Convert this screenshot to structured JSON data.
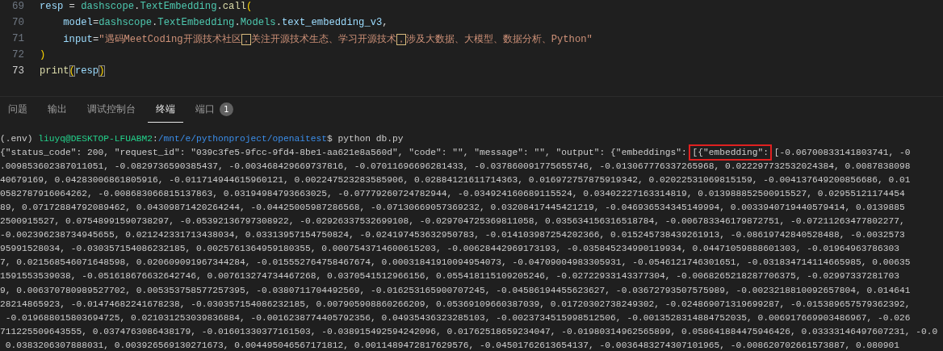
{
  "editor": {
    "lines": [
      {
        "number": "69",
        "current": false,
        "indented": false,
        "tokens": [
          {
            "text": "resp",
            "kind": "var"
          },
          {
            "text": " = ",
            "kind": "plain"
          },
          {
            "text": "dashscope",
            "kind": "class"
          },
          {
            "text": ".",
            "kind": "plain"
          },
          {
            "text": "TextEmbedding",
            "kind": "class"
          },
          {
            "text": ".",
            "kind": "plain"
          },
          {
            "text": "call",
            "kind": "func"
          },
          {
            "text": "(",
            "kind": "bracket"
          }
        ]
      },
      {
        "number": "70",
        "current": false,
        "indented": true,
        "tokens": [
          {
            "text": "model",
            "kind": "var"
          },
          {
            "text": "=",
            "kind": "plain"
          },
          {
            "text": "dashscope",
            "kind": "class"
          },
          {
            "text": ".",
            "kind": "plain"
          },
          {
            "text": "TextEmbedding",
            "kind": "class"
          },
          {
            "text": ".",
            "kind": "plain"
          },
          {
            "text": "Models",
            "kind": "class"
          },
          {
            "text": ".",
            "kind": "plain"
          },
          {
            "text": "text_embedding_v3",
            "kind": "var"
          },
          {
            "text": ",",
            "kind": "plain"
          }
        ]
      },
      {
        "number": "71",
        "current": false,
        "indented": true,
        "tokens": [
          {
            "text": "input",
            "kind": "var"
          },
          {
            "text": "=",
            "kind": "plain"
          },
          {
            "text": "\"遇码MeetCoding开源技术社区",
            "kind": "string"
          },
          {
            "text": "，",
            "kind": "ambiguous"
          },
          {
            "text": "关注开源技术生态、学习开源技术",
            "kind": "string"
          },
          {
            "text": "，",
            "kind": "ambiguous"
          },
          {
            "text": "涉及大数据、大模型、数据分析、Python\"",
            "kind": "string"
          }
        ]
      },
      {
        "number": "72",
        "current": false,
        "indented": false,
        "tokens": [
          {
            "text": ")",
            "kind": "bracket"
          }
        ]
      },
      {
        "number": "73",
        "current": true,
        "indented": false,
        "tokens": [
          {
            "text": "print",
            "kind": "func"
          },
          {
            "text": "(",
            "kind": "bracket-match"
          },
          {
            "text": "resp",
            "kind": "var"
          },
          {
            "text": ")",
            "kind": "bracket-match"
          }
        ]
      }
    ]
  },
  "panel_tabs": [
    {
      "label": "问题",
      "selected": false
    },
    {
      "label": "输出",
      "selected": false
    },
    {
      "label": "调试控制台",
      "selected": false
    },
    {
      "label": "终端",
      "selected": true
    },
    {
      "label": "端口",
      "selected": false,
      "badge": "1"
    }
  ],
  "terminal": {
    "lines": [
      [
        {
          "text": "(.env) ",
          "kind": "plain"
        },
        {
          "text": "liuyq@DESKTOP-LFUABM2",
          "kind": "user"
        },
        {
          "text": ":",
          "kind": "plain"
        },
        {
          "text": "/mnt/e/pythonproject/openaitest",
          "kind": "path"
        },
        {
          "text": "$ python db.py",
          "kind": "plain"
        }
      ],
      [
        {
          "text": "{\"status_code\": 200, \"request_id\": \"039c3fe5-9fcc-9fd4-8be1-aa621e8a560d\", \"code\": \"\", \"message\": \"\", \"output\": {\"embeddings\": ",
          "kind": "plain"
        },
        {
          "text": "[{\"embedding\":",
          "kind": "boxed"
        },
        {
          "text": " [-0.06700833141803741, -0",
          "kind": "plain"
        }
      ],
      [
        {
          "text": ".009853602387011051, -0.0829736590385437, -0.003468429669737816, -0.07011696696281433, -0.037860091775655746, -0.013067776337265968, 0.022297732532024384, 0.0087838098",
          "kind": "plain"
        }
      ],
      [
        {
          "text": "40679169, 0.04283006861805916, -0.011714944615960121, 0.002247523283585906, 0.02884121611714363, 0.016972757875919342, 0.02022531069815159, -0.004137649200856686, 0.01",
          "kind": "plain"
        }
      ],
      [
        {
          "text": "0582787916064262, -0.008683066815137863, 0.03194984793663025, -0.07779260724782944, -0.034924160689115524, 0.03402227163314819, 0.013988852500915527, 0.02955121174454",
          "kind": "plain"
        }
      ],
      [
        {
          "text": "89, 0.07172884792089462, 0.04309871420264244, -0.04425005987286568, -0.07130669057369232, 0.03208417445421219, -0.046936534345149994, 0.0033940719440579414, 0.0139885",
          "kind": "plain"
        }
      ],
      [
        {
          "text": "2500915527, 0.07548991590738297, -0.05392136797308922, -0.02926337532699108, -0.029704725369811058, 0.035634156316518784, -0.006783346179872751, -0.07211263477802277,",
          "kind": "plain"
        }
      ],
      [
        {
          "text": "-0.002396238734945655, 0.021242331713438034, 0.03313957154750824, -0.024197453632950783, -0.014103987254202366, 0.015245738439261913, -0.08619742840528488, -0.0032573",
          "kind": "plain"
        }
      ],
      [
        {
          "text": "95991528034, -0.030357154086232185, 0.0025761364959180355, 0.0007543714600615203, -0.00628442969173193, -0.035845234990119934, 0.04471059888601303, -0.01964963786303",
          "kind": "plain"
        }
      ],
      [
        {
          "text": "7, 0.021568546071648598, 0.020609091967344284, -0.015552764758467674, 0.00031841910094954073, -0.04709004983305931, -0.0546121746301651, -0.031834714114665985, 0.00635",
          "kind": "plain"
        }
      ],
      [
        {
          "text": "1591553539038, -0.051618676632642746, 0.007613274734467268, 0.0370541512966156, 0.055418115109205246, -0.02722933143377304, -0.0068265218287706375, -0.02997337281703",
          "kind": "plain"
        }
      ],
      [
        {
          "text": "9, 0.006370780989527702, 0.005353758577257395, -0.0380711704492569, -0.016253165900707245, -0.04586194455623627, -0.03672793507575989, -0.0023218810092657804, 0.014641",
          "kind": "plain"
        }
      ],
      [
        {
          "text": "28214865923, -0.01474682241678238, -0.030357154086232185, 0.007905908860266209, 0.05369109660387039, 0.01720302738249302, -0.024869071319699287, -0.015389657579362392,",
          "kind": "plain"
        }
      ],
      [
        {
          "text": " -0.019688015803694725, 0.021031253039836884, -0.0016238774405792356, 0.04935436323285103, -0.0023734515998512506, -0.0013528314884752035, 0.006917669903486967, -0.026",
          "kind": "plain"
        }
      ],
      [
        {
          "text": "711225509643555, 0.0374763086438179, -0.01601330377161503, -0.038915492594242096, 0.01762518659234047, -0.01980314962565899, 0.058641884475946426, 0.03333146497607231, -0.0",
          "kind": "plain"
        }
      ],
      [
        {
          "text": " 0.0383206307888031, 0.003926569130271673, 0.004495046567171812, 0.0011489472817629576, -0.04501762613654137, -0.0036483274307101965, -0.008620702661573887, 0.080901",
          "kind": "plain"
        }
      ]
    ]
  }
}
